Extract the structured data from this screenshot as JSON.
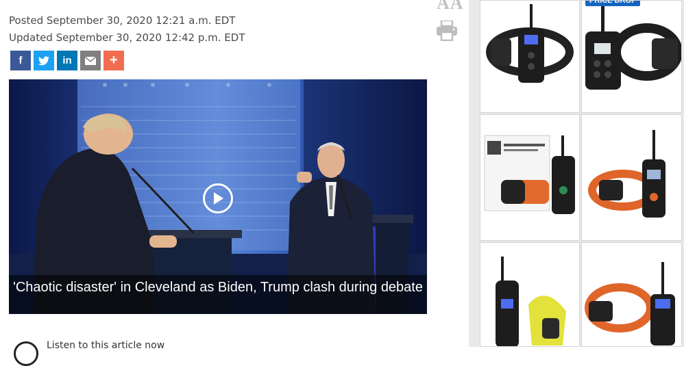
{
  "article": {
    "posted": "Posted September 30, 2020 12:21 a.m. EDT",
    "updated": "Updated September 30, 2020 12:42 p.m. EDT"
  },
  "share": {
    "facebook": "f",
    "twitter": "twitter-icon",
    "linkedin": "in",
    "email": "email-icon",
    "more": "+"
  },
  "tools": {
    "text_size": "AA",
    "print": "print-icon"
  },
  "video": {
    "caption": "'Chaotic disaster' in Cleveland as Biden, Trump clash during debate"
  },
  "listen": {
    "label": "Listen to this article now"
  },
  "ads": {
    "badge": "PRICE DROP"
  },
  "colors": {
    "facebook": "#3b5998",
    "twitter": "#1da1f2",
    "linkedin": "#0077b5",
    "email": "#7f7f7f",
    "more": "#f26d50"
  }
}
